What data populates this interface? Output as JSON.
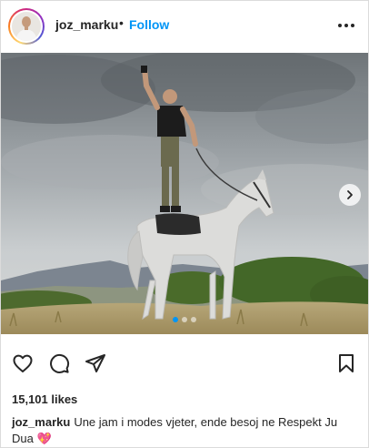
{
  "post": {
    "username": "joz_marku",
    "separator": "•",
    "follow_label": "Follow",
    "likes_text": "15,101 likes",
    "caption_user": "joz_marku",
    "caption_text": "Une jam i modes vjeter, ende besoj ne Respekt Ju Dua 💖",
    "carousel": {
      "total": 3,
      "active_index": 0
    }
  },
  "icons": {
    "more": "more-options-icon",
    "next": "chevron-right-icon",
    "like": "heart-icon",
    "comment": "comment-bubble-icon",
    "share": "paper-plane-icon",
    "save": "bookmark-icon"
  },
  "colors": {
    "accent": "#0095f6",
    "text": "#262626",
    "border": "#dbdbdb"
  }
}
